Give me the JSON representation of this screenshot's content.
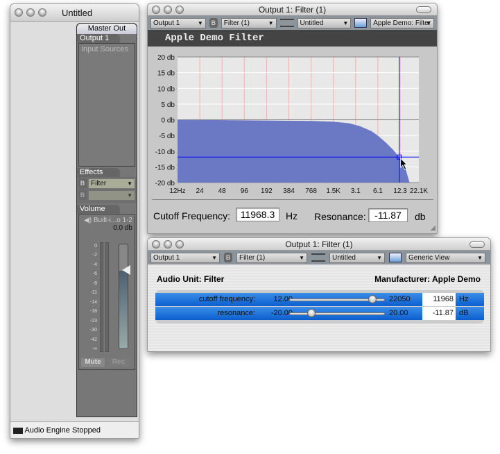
{
  "mixer": {
    "title": "Untitled",
    "master_tab": "Master Out",
    "output_tab": "Output 1",
    "input_sources": "Input Sources",
    "effects_tab": "Effects",
    "effect_slot_1": "Filter",
    "effect_slot_2": "",
    "volume_tab": "Volume",
    "device": "Built-i...o 1-2",
    "volume_db": "0.0 db",
    "meter_scale": [
      "0",
      "-2",
      "-4",
      "-6",
      "-8",
      "-11",
      "-14",
      "-18",
      "-23",
      "-30",
      "-42",
      "-∞"
    ],
    "volume_level": 0.75,
    "mute": "Mute",
    "rec": "Rec",
    "status": "Audio Engine Stopped"
  },
  "filter_custom": {
    "title": "Output 1: Filter (1)",
    "toolbar": {
      "output": "Output 1",
      "unit": "Filter (1)",
      "preset": "Untitled",
      "view": "Apple Demo: Filter"
    },
    "header": "Apple Demo Filter",
    "cutoff_label": "Cutoff Frequency:",
    "cutoff_value": "11968.3",
    "cutoff_unit": "Hz",
    "resonance_label": "Resonance:",
    "resonance_value": "-11.87",
    "resonance_unit": "db"
  },
  "chart_data": {
    "type": "area",
    "y_ticks": [
      "20 db",
      "15 db",
      "10 db",
      "5 db",
      "0 db",
      "-5 db",
      "-10 db",
      "-15 db",
      "-20 db"
    ],
    "ylim": [
      -20,
      20
    ],
    "x_ticks": [
      "12Hz",
      "24",
      "48",
      "96",
      "192",
      "384",
      "768",
      "1.5K",
      "3.1",
      "6.1",
      "12.3",
      "22.1K"
    ],
    "xlim": [
      12,
      22050
    ],
    "x_scale": "log",
    "fill_color": "#6b79c4",
    "crosshair": {
      "frequency": 11968.3,
      "db": -11.87
    },
    "curve": [
      {
        "x": 12,
        "y": 0
      },
      {
        "x": 100,
        "y": -0.2
      },
      {
        "x": 800,
        "y": -0.4
      },
      {
        "x": 1500,
        "y": -0.6
      },
      {
        "x": 2500,
        "y": -1.1
      },
      {
        "x": 3500,
        "y": -2
      },
      {
        "x": 5000,
        "y": -3.6
      },
      {
        "x": 6100,
        "y": -5
      },
      {
        "x": 8000,
        "y": -7.4
      },
      {
        "x": 10000,
        "y": -9.7
      },
      {
        "x": 12300,
        "y": -12.3
      },
      {
        "x": 14500,
        "y": -15.5
      },
      {
        "x": 16500,
        "y": -20
      }
    ]
  },
  "filter_generic": {
    "title": "Output 1: Filter (1)",
    "toolbar": {
      "output": "Output 1",
      "unit": "Filter (1)",
      "preset": "Untitled",
      "view": "Generic View"
    },
    "au_label": "Audio Unit: Filter",
    "manufacturer": "Manufacturer: Apple Demo",
    "params": [
      {
        "label": "cutoff frequency:",
        "min": "12.00",
        "max": "22050",
        "value": "11968",
        "unit": "Hz",
        "position": 0.88
      },
      {
        "label": "resonance:",
        "min": "-20.00",
        "max": "20.00",
        "value": "-11.87",
        "unit": "dB",
        "position": 0.21
      }
    ]
  }
}
